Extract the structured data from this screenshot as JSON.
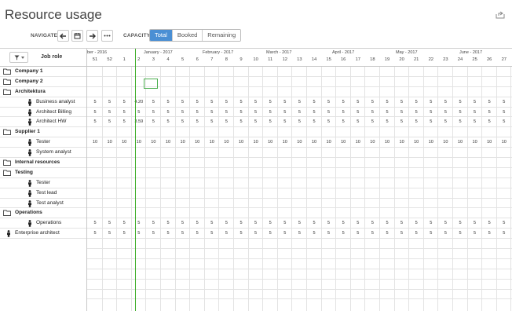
{
  "header": {
    "title": "Resource usage"
  },
  "toolbar": {
    "navigate_label": "NAVIGATE:",
    "capacity_label": "CAPACITY :",
    "capacity_options": [
      "Total",
      "Booked",
      "Remaining"
    ],
    "capacity_selected": "Total"
  },
  "left": {
    "job_role_header": "Job role",
    "rows": [
      {
        "type": "group",
        "label": "Company 1"
      },
      {
        "type": "group",
        "label": "Company 2"
      },
      {
        "type": "group",
        "label": "Architektura"
      },
      {
        "type": "person",
        "label": "Business analyst"
      },
      {
        "type": "person",
        "label": "Architect Billing"
      },
      {
        "type": "person",
        "label": "Architect HW"
      },
      {
        "type": "group",
        "label": "Supplier 1"
      },
      {
        "type": "person",
        "label": "Tester"
      },
      {
        "type": "person",
        "label": "System analyst"
      },
      {
        "type": "group",
        "label": "Internal resources"
      },
      {
        "type": "group",
        "label": "Testing"
      },
      {
        "type": "person",
        "label": "Tester"
      },
      {
        "type": "person",
        "label": "Test lead"
      },
      {
        "type": "person",
        "label": "Test analyst"
      },
      {
        "type": "group",
        "label": "Operations"
      },
      {
        "type": "person",
        "label": "Operations"
      },
      {
        "type": "person-top",
        "label": "Enterprise architect"
      }
    ]
  },
  "timeline": {
    "months": [
      {
        "label": "ber - 2016"
      },
      {
        "label": "January - 2017"
      },
      {
        "label": "February - 2017"
      },
      {
        "label": "March - 2017"
      },
      {
        "label": "April - 2017"
      },
      {
        "label": "May - 2017"
      },
      {
        "label": "June - 2017"
      }
    ],
    "weeks": [
      "51",
      "52",
      "1",
      "2",
      "3",
      "4",
      "5",
      "6",
      "7",
      "8",
      "9",
      "10",
      "11",
      "12",
      "13",
      "14",
      "15",
      "16",
      "17",
      "18",
      "19",
      "20",
      "21",
      "22",
      "23",
      "24",
      "25",
      "26",
      "27"
    ]
  },
  "values": {
    "business_analyst": [
      "5",
      "5",
      "5",
      "4.20",
      "5",
      "5",
      "5",
      "5",
      "5",
      "5",
      "5",
      "5",
      "5",
      "5",
      "5",
      "5",
      "5",
      "5",
      "5",
      "5",
      "5",
      "5",
      "5",
      "5",
      "5",
      "5",
      "5",
      "5",
      "5"
    ],
    "architect_billing": [
      "5",
      "5",
      "5",
      "5",
      "5",
      "5",
      "5",
      "5",
      "5",
      "5",
      "5",
      "5",
      "5",
      "5",
      "5",
      "5",
      "5",
      "5",
      "5",
      "5",
      "5",
      "5",
      "5",
      "5",
      "5",
      "5",
      "5",
      "5",
      "5"
    ],
    "architect_hw": [
      "5",
      "5",
      "5",
      "3.59",
      "5",
      "5",
      "5",
      "5",
      "5",
      "5",
      "5",
      "5",
      "5",
      "5",
      "5",
      "5",
      "5",
      "5",
      "5",
      "5",
      "5",
      "5",
      "5",
      "5",
      "5",
      "5",
      "5",
      "5",
      "5"
    ],
    "tester": [
      "10",
      "10",
      "10",
      "10",
      "10",
      "10",
      "10",
      "10",
      "10",
      "10",
      "10",
      "10",
      "10",
      "10",
      "10",
      "10",
      "10",
      "10",
      "10",
      "10",
      "10",
      "10",
      "10",
      "10",
      "10",
      "10",
      "10",
      "10",
      "10"
    ],
    "operations": [
      "5",
      "5",
      "5",
      "5",
      "5",
      "5",
      "5",
      "5",
      "5",
      "5",
      "5",
      "5",
      "5",
      "5",
      "5",
      "5",
      "5",
      "5",
      "5",
      "5",
      "5",
      "5",
      "5",
      "5",
      "5",
      "5",
      "5",
      "5",
      "5"
    ],
    "enterprise_architect": [
      "5",
      "5",
      "5",
      "5",
      "5",
      "5",
      "5",
      "5",
      "5",
      "5",
      "5",
      "5",
      "5",
      "5",
      "5",
      "5",
      "5",
      "5",
      "5",
      "5",
      "5",
      "5",
      "5",
      "5",
      "5",
      "5",
      "5",
      "5",
      "5"
    ]
  },
  "colors": {
    "accent": "#4a8fd4",
    "today": "#3fae2a",
    "grid": "#e3e3e3"
  }
}
